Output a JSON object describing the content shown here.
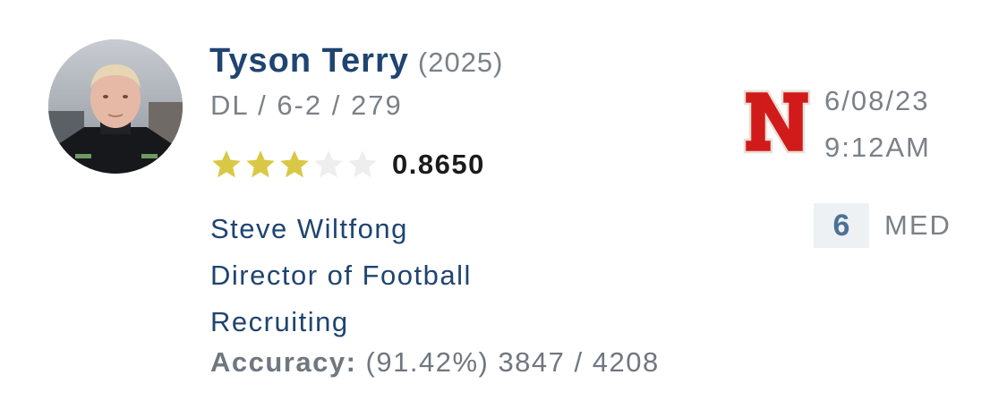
{
  "player": {
    "name": "Tyson Terry",
    "year": "(2025)",
    "meta": "DL / 6-2 / 279",
    "rating": "0.8650",
    "stars": 3,
    "max_stars": 5
  },
  "analyst": {
    "name": "Steve Wiltfong",
    "title_line1": "Director of Football",
    "title_line2": "Recruiting",
    "accuracy_label": "Accuracy:",
    "accuracy_value": "(91.42%) 3847 / 4208"
  },
  "prediction": {
    "team_logo": "nebraska-n-logo",
    "date": "6/08/23",
    "time": "9:12AM",
    "confidence_value": "6",
    "confidence_label": "MED"
  },
  "colors": {
    "star_filled": "#d9c845",
    "star_empty": "#eeeeee",
    "name_blue": "#1f4470",
    "logo_red": "#d11a1a"
  }
}
